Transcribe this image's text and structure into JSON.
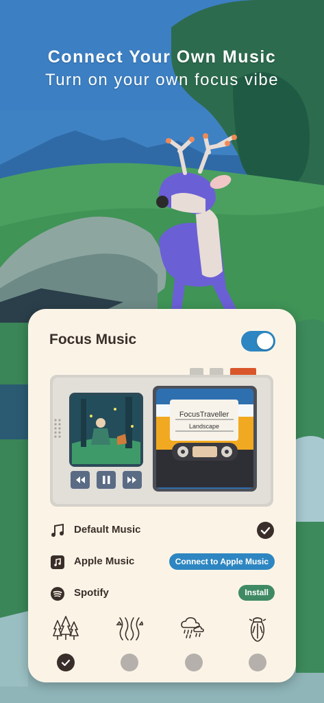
{
  "headline": {
    "title": "Connect Your Own Music",
    "subtitle": "Turn on your own focus vibe"
  },
  "card": {
    "title": "Focus Music",
    "toggle_on": true
  },
  "player": {
    "cassette_title": "FocusTraveller",
    "cassette_subtitle": "Landscape",
    "controls": [
      "rewind-icon",
      "pause-icon",
      "fast-forward-icon"
    ]
  },
  "sources": [
    {
      "label": "Default Music",
      "icon": "music-note-icon",
      "action": "selected-check"
    },
    {
      "label": "Apple Music",
      "icon": "apple-music-icon",
      "action": "Connect to Apple Music"
    },
    {
      "label": "Spotify",
      "icon": "spotify-icon",
      "action": "Install"
    }
  ],
  "scenes": [
    {
      "icon": "forest-icon",
      "selected": true
    },
    {
      "icon": "stream-icon",
      "selected": false
    },
    {
      "icon": "rain-cloud-icon",
      "selected": false
    },
    {
      "icon": "cicada-icon",
      "selected": false
    }
  ],
  "colors": {
    "card_bg": "#fbf4e6",
    "accent_blue": "#2d86c1",
    "install_green": "#3f8a64",
    "text_dark": "#3a2e2a",
    "cassette_yellow": "#f2a922"
  }
}
